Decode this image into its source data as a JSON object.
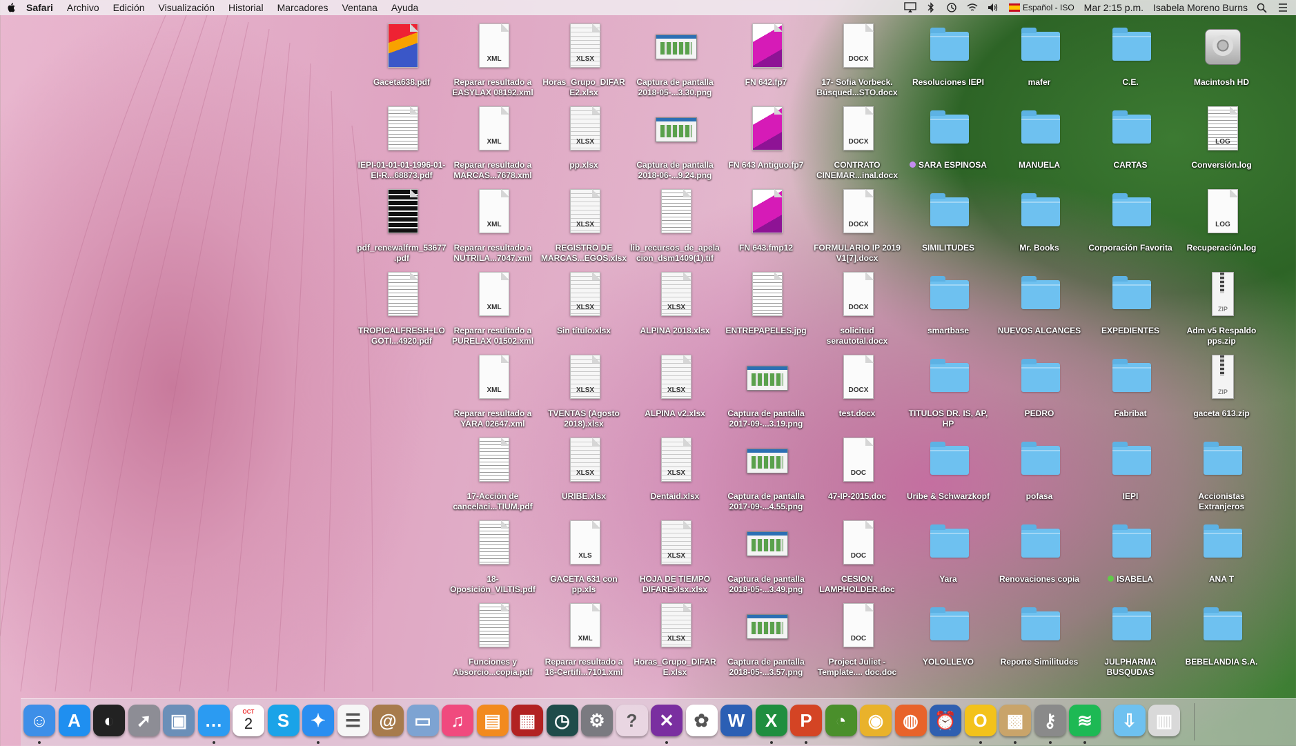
{
  "menubar": {
    "app": "Safari",
    "items": [
      "Archivo",
      "Edición",
      "Visualización",
      "Historial",
      "Marcadores",
      "Ventana",
      "Ayuda"
    ],
    "input_source": "Español - ISO",
    "clock": "Mar 2:15 p.m.",
    "user": "Isabela Moreno Burns"
  },
  "desktop": {
    "icons": [
      {
        "name": "Gaceta638.pdf",
        "kind": "cover"
      },
      {
        "name": "Reparar resultado a EASYLAX 08192.xml",
        "kind": "doc",
        "ext": "XML"
      },
      {
        "name": "Horas_Grupo_DIFAR E2.xlsx",
        "kind": "grid",
        "ext": "XLSX"
      },
      {
        "name": "Captura de pantalla 2018-05-...3.30.png",
        "kind": "shot"
      },
      {
        "name": "FN 642.fp7",
        "kind": "pink"
      },
      {
        "name": "17- Sofia Vorbeck. Búsqued...STO.docx",
        "kind": "doc",
        "ext": "DOCX"
      },
      {
        "name": "Resoluciones IEPI",
        "kind": "folder"
      },
      {
        "name": "mafer",
        "kind": "folder"
      },
      {
        "name": "C.E.",
        "kind": "folder"
      },
      {
        "name": "Macintosh HD",
        "kind": "hd"
      },
      {
        "name": "IEPI-01-01-01-1996-01-EI-R...68873.pdf",
        "kind": "text"
      },
      {
        "name": "Reparar resultado a MARCAS...7678.xml",
        "kind": "doc",
        "ext": "XML"
      },
      {
        "name": "pp.xlsx",
        "kind": "grid",
        "ext": "XLSX"
      },
      {
        "name": "Captura de pantalla 2018-06-...9.24.png",
        "kind": "shot"
      },
      {
        "name": "FN 643 Antiguo.fp7",
        "kind": "pink"
      },
      {
        "name": "CONTRATO CINEMAR...inal.docx",
        "kind": "doc",
        "ext": "DOCX"
      },
      {
        "name": "SARA ESPINOSA",
        "kind": "folder",
        "tag": "#c58cf0"
      },
      {
        "name": "MANUELA",
        "kind": "folder"
      },
      {
        "name": "CARTAS",
        "kind": "folder"
      },
      {
        "name": "Conversión.log",
        "kind": "text",
        "ext": "LOG"
      },
      {
        "name": "pdf_renewalfrm_53677.pdf",
        "kind": "black"
      },
      {
        "name": "Reparar resultado a NUTRILA...7047.xml",
        "kind": "doc",
        "ext": "XML"
      },
      {
        "name": "REGISTRO DE MARCAS...EGOS.xlsx",
        "kind": "grid",
        "ext": "XLSX"
      },
      {
        "name": "lib_recursos_de_apelacion_dsm1409(1).tif",
        "kind": "text"
      },
      {
        "name": "FN 643.fmp12",
        "kind": "pink"
      },
      {
        "name": "FORMULARIO IP 2019 V1[7].docx",
        "kind": "doc",
        "ext": "DOCX"
      },
      {
        "name": "SIMILITUDES",
        "kind": "folder"
      },
      {
        "name": "Mr. Books",
        "kind": "folder"
      },
      {
        "name": "Corporación Favorita",
        "kind": "folder"
      },
      {
        "name": "Recuperación.log",
        "kind": "doc",
        "ext": "LOG"
      },
      {
        "name": "TROPICALFRESH+LOGOTI...4920.pdf",
        "kind": "text"
      },
      {
        "name": "Reparar resultado a PURELAX 01502.xml",
        "kind": "doc",
        "ext": "XML"
      },
      {
        "name": "Sin título.xlsx",
        "kind": "grid",
        "ext": "XLSX"
      },
      {
        "name": "ALPINA 2018.xlsx",
        "kind": "grid",
        "ext": "XLSX"
      },
      {
        "name": "ENTREPAPELES.jpg",
        "kind": "text"
      },
      {
        "name": "solicitud serautotal.docx",
        "kind": "doc",
        "ext": "DOCX"
      },
      {
        "name": "smartbase",
        "kind": "folder"
      },
      {
        "name": "NUEVOS ALCANCES",
        "kind": "folder"
      },
      {
        "name": "EXPEDIENTES",
        "kind": "folder"
      },
      {
        "name": "Adm v5 Respaldo pps.zip",
        "kind": "zip",
        "ext": "ZIP"
      },
      {
        "name": "Reparar resultado a YARA 02647.xml",
        "kind": "doc",
        "ext": "XML"
      },
      {
        "name": "TVENTAS (Agosto 2018).xlsx",
        "kind": "grid",
        "ext": "XLSX"
      },
      {
        "name": "ALPINA v2.xlsx",
        "kind": "grid",
        "ext": "XLSX"
      },
      {
        "name": "Captura de pantalla 2017-09-...3.19.png",
        "kind": "shot"
      },
      {
        "name": "test.docx",
        "kind": "doc",
        "ext": "DOCX"
      },
      {
        "name": "TITULOS DR. IS, AP, HP",
        "kind": "folder"
      },
      {
        "name": "PEDRO",
        "kind": "folder"
      },
      {
        "name": "Fabribat",
        "kind": "folder"
      },
      {
        "name": "gaceta 613.zip",
        "kind": "zip",
        "ext": "ZIP"
      },
      {
        "name": "17-Acción de cancelaci...TIUM.pdf",
        "kind": "text"
      },
      {
        "name": "URIBE.xlsx",
        "kind": "grid",
        "ext": "XLSX"
      },
      {
        "name": "Dentaid.xlsx",
        "kind": "grid",
        "ext": "XLSX"
      },
      {
        "name": "Captura de pantalla 2017-09-...4.55.png",
        "kind": "shot"
      },
      {
        "name": "47-IP-2015.doc",
        "kind": "doc",
        "ext": "DOC"
      },
      {
        "name": "Uribe & Schwarzkopf",
        "kind": "folder"
      },
      {
        "name": "pofasa",
        "kind": "folder"
      },
      {
        "name": "IEPI",
        "kind": "folder"
      },
      {
        "name": "Accionistas Extranjeros",
        "kind": "folder"
      },
      {
        "name": "18-Oposición_VILTIS.pdf",
        "kind": "text"
      },
      {
        "name": "GACETA 631 con pp.xls",
        "kind": "doc",
        "ext": "XLS"
      },
      {
        "name": "HOJA DE TIEMPO DIFARExlsx.xlsx",
        "kind": "grid",
        "ext": "XLSX"
      },
      {
        "name": "Captura de pantalla 2018-05-...3.49.png",
        "kind": "shot"
      },
      {
        "name": "CESION LAMPHOLDER.doc",
        "kind": "doc",
        "ext": "DOC"
      },
      {
        "name": "Yara",
        "kind": "folder"
      },
      {
        "name": "Renovaciones copia",
        "kind": "folder"
      },
      {
        "name": "ISABELA",
        "kind": "folder",
        "tag": "#62c94a"
      },
      {
        "name": "ANA T",
        "kind": "folder"
      },
      {
        "name": "Funciones y Absorcio...copia.pdf",
        "kind": "text"
      },
      {
        "name": "Reparar resultado a 18-Certifi...7101.xml",
        "kind": "doc",
        "ext": "XML"
      },
      {
        "name": "Horas_Grupo_DIFAR E.xlsx",
        "kind": "grid",
        "ext": "XLSX"
      },
      {
        "name": "Captura de pantalla 2018-05-...3.57.png",
        "kind": "shot"
      },
      {
        "name": "Project Juliet - Template.... doc.doc",
        "kind": "doc",
        "ext": "DOC"
      },
      {
        "name": "YOLOLLEVO",
        "kind": "folder"
      },
      {
        "name": "Reporte Similitudes",
        "kind": "folder"
      },
      {
        "name": "JULPHARMA BUSQUDAS",
        "kind": "folder"
      },
      {
        "name": "BEBELANDIA S.A.",
        "kind": "folder"
      }
    ]
  },
  "dock": {
    "calendar_month": "OCT",
    "calendar_day": "2",
    "apps": [
      {
        "name": "finder-icon",
        "glyph": "☺",
        "bg": "#3d8fe8"
      },
      {
        "name": "app-store-icon",
        "glyph": "A",
        "bg": "#1f8ff0"
      },
      {
        "name": "dashboard-icon",
        "glyph": "◐",
        "bg": "#222"
      },
      {
        "name": "launchpad-icon",
        "glyph": "➚",
        "bg": "#8d8d95"
      },
      {
        "name": "preview-icon",
        "glyph": "▣",
        "bg": "#6b8fb8"
      },
      {
        "name": "messages-icon",
        "glyph": "…",
        "bg": "#2b9bf2"
      },
      {
        "name": "calendar-icon",
        "glyph": "",
        "bg": "#fff"
      },
      {
        "name": "skype-icon",
        "glyph": "S",
        "bg": "#1aa3e8"
      },
      {
        "name": "safari-icon",
        "glyph": "✦",
        "bg": "#2a8ef0"
      },
      {
        "name": "reminders-icon",
        "glyph": "☰",
        "bg": "#f6f6f6"
      },
      {
        "name": "contacts-icon",
        "glyph": "@",
        "bg": "#a77b4c"
      },
      {
        "name": "photo-booth-icon",
        "glyph": "▭",
        "bg": "#7da3d2"
      },
      {
        "name": "itunes-icon",
        "glyph": "♫",
        "bg": "#f04a7e"
      },
      {
        "name": "ibooks-icon",
        "glyph": "▤",
        "bg": "#f28a1e"
      },
      {
        "name": "photo-booth-2-icon",
        "glyph": "▦",
        "bg": "#b22222"
      },
      {
        "name": "time-machine-icon",
        "glyph": "◷",
        "bg": "#1f4c4a"
      },
      {
        "name": "system-preferences-icon",
        "glyph": "⚙",
        "bg": "#7a7a80"
      },
      {
        "name": "help-icon",
        "glyph": "?",
        "bg": "rgba(255,255,255,0.25)"
      },
      {
        "name": "filemaker-icon",
        "glyph": "✕",
        "bg": "#7a2fa0"
      },
      {
        "name": "photos-icon",
        "glyph": "✿",
        "bg": "#fff"
      },
      {
        "name": "word-icon",
        "glyph": "W",
        "bg": "#2b5fb4"
      },
      {
        "name": "excel-icon",
        "glyph": "X",
        "bg": "#1f8e3f"
      },
      {
        "name": "powerpoint-icon",
        "glyph": "P",
        "bg": "#d44424"
      },
      {
        "name": "clock-app-icon",
        "glyph": "◔",
        "bg": "#4a8f2b"
      },
      {
        "name": "chrome-icon",
        "glyph": "◉",
        "bg": "#e9b22b"
      },
      {
        "name": "firefox-icon",
        "glyph": "◍",
        "bg": "#e8632a"
      },
      {
        "name": "timer-icon",
        "glyph": "⏰",
        "bg": "#2f5fb0"
      },
      {
        "name": "opera-icon",
        "glyph": "O",
        "bg": "#f3c21b"
      },
      {
        "name": "preview-2-icon",
        "glyph": "▩",
        "bg": "#c9a46a"
      },
      {
        "name": "keychain-icon",
        "glyph": "⚷",
        "bg": "#8a8a8a"
      },
      {
        "name": "spotify-icon",
        "glyph": "≋",
        "bg": "#1db954"
      },
      {
        "name": "downloads-folder-icon",
        "glyph": "⇩",
        "bg": "#6ec1f0"
      },
      {
        "name": "trash-icon",
        "glyph": "▥",
        "bg": "#d9d9d9"
      }
    ]
  },
  "colors": {
    "folder": "#6ec1f0",
    "menubar": "#f0ebf0"
  }
}
